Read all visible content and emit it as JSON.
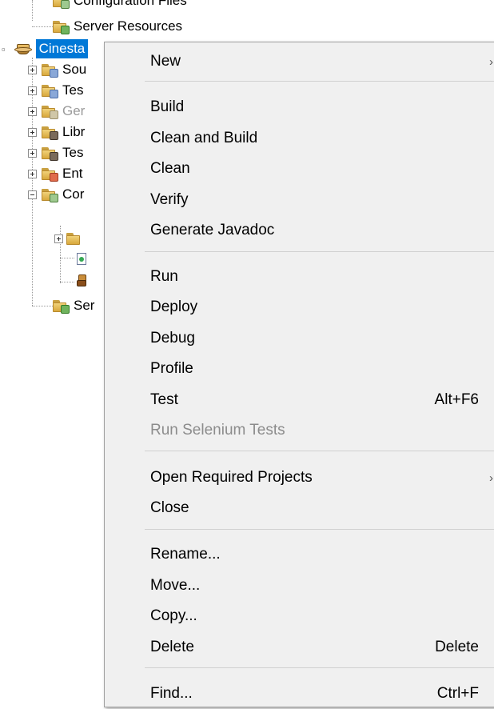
{
  "tree": {
    "top_partial": "Configuration Files",
    "server_resources": "Server Resources",
    "project": "Cinesta",
    "children": [
      {
        "label": "Source Packages",
        "shown": "Sou",
        "disabled": false,
        "badge": "pkg"
      },
      {
        "label": "Test Packages",
        "shown": "Tes",
        "disabled": false,
        "badge": "pkg"
      },
      {
        "label": "Generated Sources",
        "shown": "Ger",
        "disabled": true,
        "badge": "gen"
      },
      {
        "label": "Libraries",
        "shown": "Libr",
        "disabled": false,
        "badge": "jar"
      },
      {
        "label": "Test Libraries",
        "shown": "Tes",
        "disabled": false,
        "badge": "jar"
      },
      {
        "label": "Enterprise Beans",
        "shown": "Ent",
        "disabled": false,
        "badge": "ent"
      },
      {
        "label": "Configuration Files",
        "shown": "Cor",
        "disabled": false,
        "badge": "cfg"
      }
    ],
    "last_child": "Ser"
  },
  "menu": {
    "items": [
      {
        "label": "New",
        "accel": "",
        "submenu": true,
        "disabled": false
      },
      {
        "label": "Build",
        "accel": "",
        "submenu": false,
        "disabled": false
      },
      {
        "label": "Clean and Build",
        "accel": "",
        "submenu": false,
        "disabled": false
      },
      {
        "label": "Clean",
        "accel": "",
        "submenu": false,
        "disabled": false
      },
      {
        "label": "Verify",
        "accel": "",
        "submenu": false,
        "disabled": false
      },
      {
        "label": "Generate Javadoc",
        "accel": "",
        "submenu": false,
        "disabled": false
      },
      {
        "label": "Run",
        "accel": "",
        "submenu": false,
        "disabled": false
      },
      {
        "label": "Deploy",
        "accel": "",
        "submenu": false,
        "disabled": false
      },
      {
        "label": "Debug",
        "accel": "",
        "submenu": false,
        "disabled": false
      },
      {
        "label": "Profile",
        "accel": "",
        "submenu": false,
        "disabled": false
      },
      {
        "label": "Test",
        "accel": "Alt+F6",
        "submenu": false,
        "disabled": false
      },
      {
        "label": "Run Selenium Tests",
        "accel": "",
        "submenu": false,
        "disabled": true
      },
      {
        "label": "Open Required Projects",
        "accel": "",
        "submenu": true,
        "disabled": false
      },
      {
        "label": "Close",
        "accel": "",
        "submenu": false,
        "disabled": false
      },
      {
        "label": "Rename...",
        "accel": "",
        "submenu": false,
        "disabled": false
      },
      {
        "label": "Move...",
        "accel": "",
        "submenu": false,
        "disabled": false
      },
      {
        "label": "Copy...",
        "accel": "",
        "submenu": false,
        "disabled": false
      },
      {
        "label": "Delete",
        "accel": "Delete",
        "submenu": false,
        "disabled": false
      },
      {
        "label": "Find...",
        "accel": "Ctrl+F",
        "submenu": false,
        "disabled": false
      }
    ],
    "submenu_glyph": "›"
  }
}
